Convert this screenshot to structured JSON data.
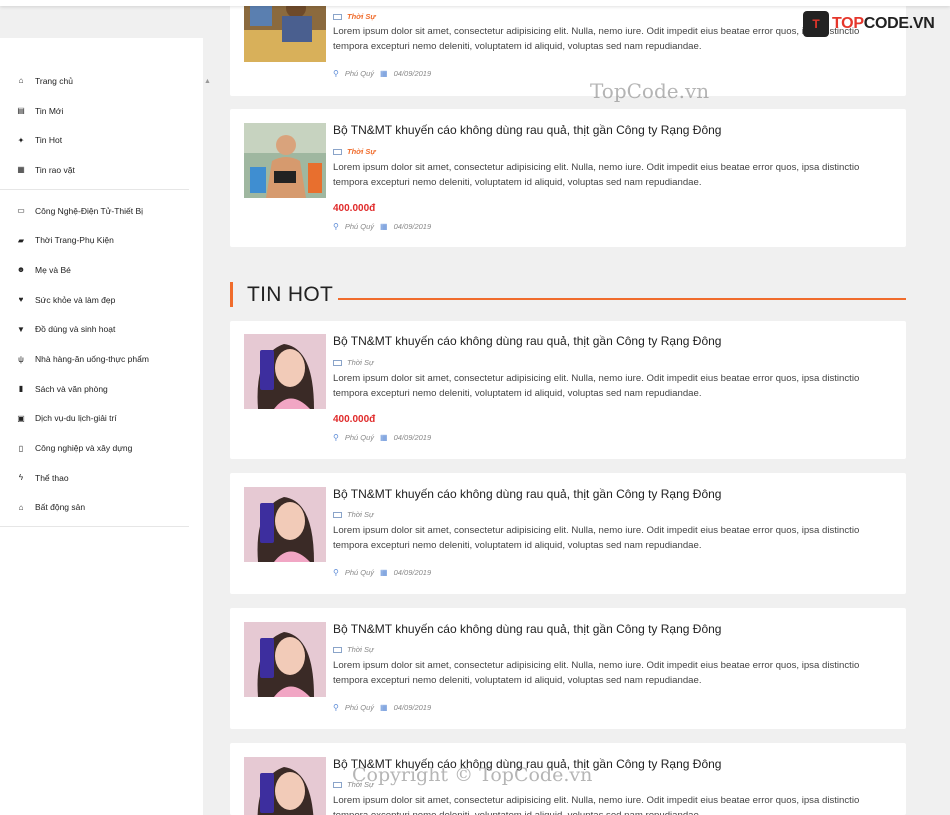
{
  "logo": {
    "prefix": "TOP",
    "suffix": "CODE.VN",
    "mark": "T"
  },
  "watermarks": {
    "top": "TopCode.vn",
    "bottom": "Copyright © TopCode.vn"
  },
  "sidebar": {
    "group1": [
      {
        "label": "Trang chủ",
        "icon": "home-icon",
        "glyph": "⌂"
      },
      {
        "label": "Tin Mới",
        "icon": "newspaper-icon",
        "glyph": "▤"
      },
      {
        "label": "Tin Hot",
        "icon": "fire-icon",
        "glyph": "✦"
      },
      {
        "label": "Tin rao vặt",
        "icon": "calendar-icon",
        "glyph": "▦"
      }
    ],
    "group2": [
      {
        "label": "Công Nghệ-Điện Tử-Thiết Bị",
        "icon": "laptop-icon",
        "glyph": "▭"
      },
      {
        "label": "Thời Trang-Phụ Kiện",
        "icon": "bag-icon",
        "glyph": "▰"
      },
      {
        "label": "Mẹ và Bé",
        "icon": "users-icon",
        "glyph": "☻"
      },
      {
        "label": "Sức khỏe và làm đẹp",
        "icon": "heartbeat-icon",
        "glyph": "♥"
      },
      {
        "label": "Đồ dùng và sinh hoạt",
        "icon": "glass-icon",
        "glyph": "▼"
      },
      {
        "label": "Nhà hàng-ăn uống-thực phẩm",
        "icon": "cutlery-icon",
        "glyph": "ψ"
      },
      {
        "label": "Sách và văn phòng",
        "icon": "book-icon",
        "glyph": "▮"
      },
      {
        "label": "Dịch vụ-du lịch-giải trí",
        "icon": "suitcase-icon",
        "glyph": "▣"
      },
      {
        "label": "Công nghiệp và xây dựng",
        "icon": "building-icon",
        "glyph": "▯"
      },
      {
        "label": "Thể thao",
        "icon": "bolt-icon",
        "glyph": "ϟ"
      },
      {
        "label": "Bất động sản",
        "icon": "home-icon",
        "glyph": "⌂"
      }
    ]
  },
  "section": {
    "title": "TIN HOT"
  },
  "desc_line1": "Lorem ipsum dolor sit amet, consectetur adipisicing elit. Nulla, nemo iure. Odit impedit eius beatae error quos, ipsa distinctio",
  "desc_line2": "tempora excepturi nemo deleniti, voluptatem id aliquid, voluptas sed nam repudiandae.",
  "cards": [
    {
      "title": "",
      "category": "Thời Sự",
      "location": "Phú Quý",
      "date": "04/09/2019",
      "price": ""
    },
    {
      "title": "Bộ TN&MT khuyến cáo không dùng rau quả, thịt gần Công ty Rạng Đông",
      "category": "Thời Sự",
      "location": "Phú Quý",
      "date": "04/09/2019",
      "price": "400.000đ"
    },
    {
      "title": "Bộ TN&MT khuyến cáo không dùng rau quả, thịt gần Công ty Rạng Đông",
      "category": "Thời Sự",
      "location": "Phú Quý",
      "date": "04/09/2019",
      "price": "400.000đ"
    },
    {
      "title": "Bộ TN&MT khuyến cáo không dùng rau quả, thịt gần Công ty Rạng Đông",
      "category": "Thời Sự",
      "location": "Phú Quý",
      "date": "04/09/2019",
      "price": ""
    },
    {
      "title": "Bộ TN&MT khuyến cáo không dùng rau quả, thịt gần Công ty Rạng Đông",
      "category": "Thời Sự",
      "location": "Phú Quý",
      "date": "04/09/2019",
      "price": ""
    },
    {
      "title": "Bộ TN&MT khuyến cáo không dùng rau quả, thịt gần Công ty Rạng Đông",
      "category": "Thời Sự",
      "location": "",
      "date": "",
      "price": ""
    }
  ]
}
